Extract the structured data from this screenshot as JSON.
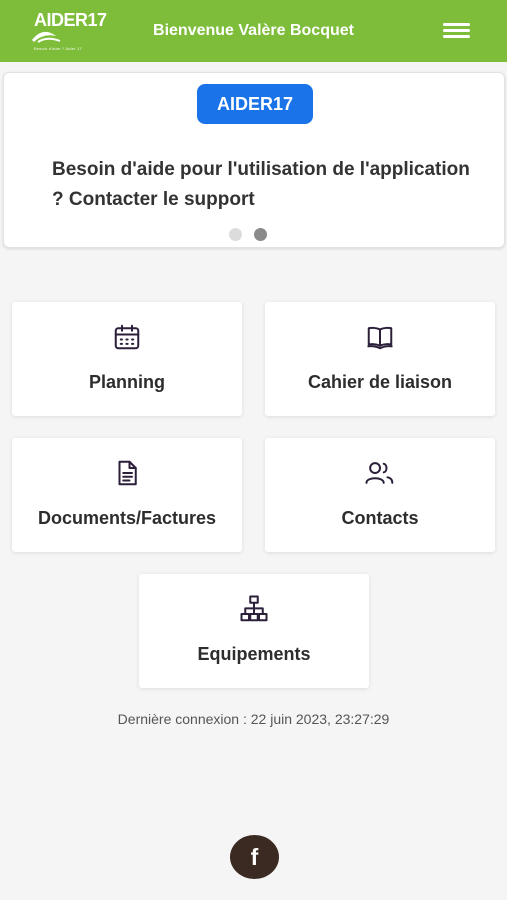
{
  "header": {
    "logo_text": "AIDER17",
    "logo_tagline": "Besoin d'aide ? Aider 17",
    "title": "Bienvenue Valère Bocquet",
    "menu_icon": "hamburger-icon",
    "bg_color": "#7dbd3a"
  },
  "carousel": {
    "badge": "AIDER17",
    "badge_color": "#1a73e8",
    "text": "Besoin d'aide pour l'utilisation de l'application ? Contacter le support",
    "slide_count": 2,
    "active_slide": 2
  },
  "tiles": [
    {
      "label": "Planning",
      "icon": "calendar-icon"
    },
    {
      "label": "Cahier de liaison",
      "icon": "book-icon"
    },
    {
      "label": "Documents/Factures",
      "icon": "document-icon"
    },
    {
      "label": "Contacts",
      "icon": "users-icon"
    },
    {
      "label": "Equipements",
      "icon": "sitemap-icon"
    }
  ],
  "last_login": "Dernière connexion : 22 juin 2023, 23:27:29",
  "footer": {
    "facebook_icon": "facebook-icon",
    "facebook_glyph": "f"
  }
}
